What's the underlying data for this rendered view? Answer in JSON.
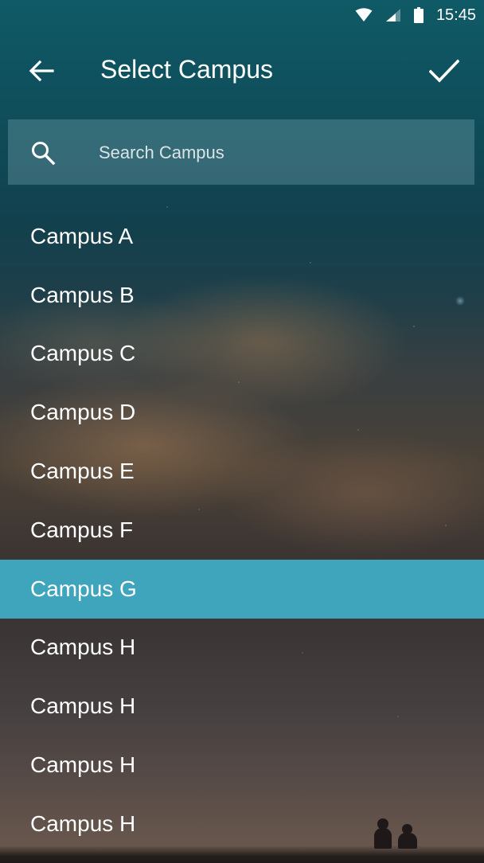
{
  "status_bar": {
    "time": "15:45",
    "icons": [
      "wifi-icon",
      "cellular-signal-icon",
      "battery-icon"
    ]
  },
  "toolbar": {
    "title": "Select Campus",
    "back_icon": "arrow-left-icon",
    "confirm_icon": "checkmark-icon"
  },
  "search": {
    "placeholder": "Search Campus",
    "value": "",
    "icon": "search-icon"
  },
  "campus_list": {
    "selected_index": 6,
    "items": [
      {
        "label": "Campus A"
      },
      {
        "label": "Campus B"
      },
      {
        "label": "Campus C"
      },
      {
        "label": "Campus D"
      },
      {
        "label": "Campus E"
      },
      {
        "label": "Campus F"
      },
      {
        "label": "Campus G"
      },
      {
        "label": "Campus H"
      },
      {
        "label": "Campus H"
      },
      {
        "label": "Campus H"
      },
      {
        "label": "Campus H"
      }
    ]
  },
  "colors": {
    "selected_row": "#3ea5bd",
    "text": "#ffffff",
    "search_box": "rgba(150,195,205,0.28)"
  }
}
